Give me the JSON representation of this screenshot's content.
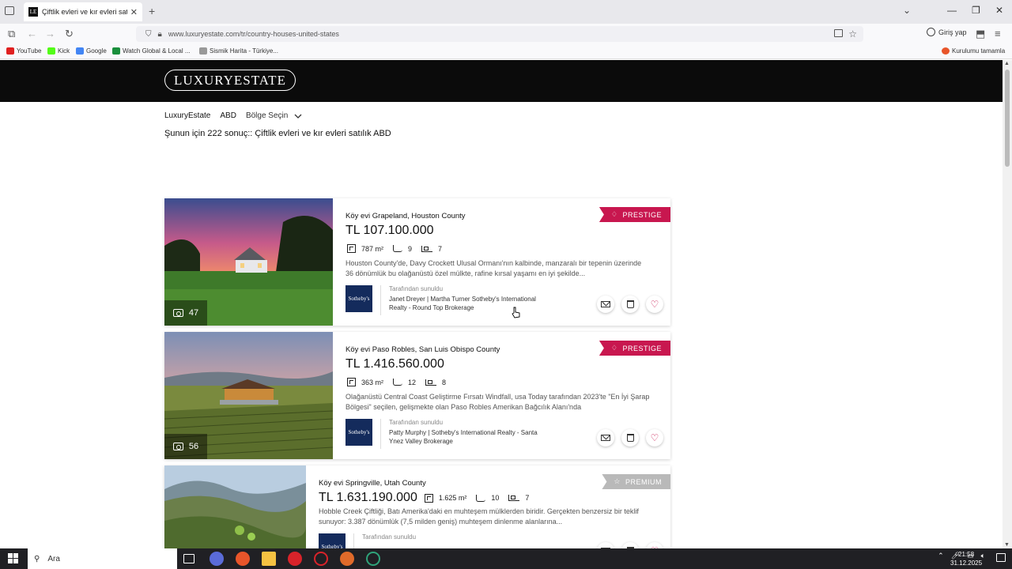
{
  "browser": {
    "tab_title": "Çiftlik evleri ve kır evleri satılık",
    "tab_favicon": "LE",
    "url": "www.luxuryestate.com/tr/country-houses-united-states",
    "signin_label": "Giriş yap",
    "bookmarks": [
      {
        "label": "YouTube",
        "color": "#e02020"
      },
      {
        "label": "Kick",
        "color": "#53fc18"
      },
      {
        "label": "Google",
        "color": "#4285f4"
      },
      {
        "label": "Watch Global & Local ...",
        "color": "#1a8f3c"
      },
      {
        "label": "Sismik Harita - Türkiye...",
        "color": "#999999"
      }
    ],
    "bookmark_right": "Kurulumu tamamla"
  },
  "site": {
    "logo": "LUXURYESTATE",
    "breadcrumb": [
      "LuxuryEstate",
      "ABD"
    ],
    "region_select": "Bölge Seçin",
    "results_text": "Şunun için 222 sonuç:: Çiftlik evleri ve kır evleri satılık ABD"
  },
  "listings": [
    {
      "badge": "PRESTIGE",
      "title": "Köy evi Grapeland, Houston County",
      "price": "TL 107.100.000",
      "area": "787 m²",
      "baths": "9",
      "beds": "7",
      "description": "Houston County'de, Davy Crockett Ulusal Ormanı'nın kalbinde, manzaralı bir tepenin üzerinde 36 dönümlük bu olağanüstü özel mülkte, rafine kırsal yaşamı en iyi şekilde...",
      "photo_count": "47",
      "offered_by": "Tarafından sunuldu",
      "agent": "Janet Dreyer | Martha Turner Sotheby's International Realty - Round Top Brokerage",
      "agency_logo": "Sotheby's"
    },
    {
      "badge": "PRESTIGE",
      "title": "Köy evi Paso Robles, San Luis Obispo County",
      "price": "TL 1.416.560.000",
      "area": "363 m²",
      "baths": "12",
      "beds": "8",
      "description": "Olağanüstü Central Coast Geliştirme Fırsatı Windfall, usa Today tarafından 2023'te \"En İyi Şarap Bölgesi\" seçilen, gelişmekte olan Paso Robles Amerikan Bağcılık Alanı'nda",
      "photo_count": "56",
      "offered_by": "Tarafından sunuldu",
      "agent": "Patty Murphy | Sotheby's International Realty - Santa Ynez Valley Brokerage",
      "agency_logo": "Sotheby's"
    },
    {
      "badge": "PREMIUM",
      "title": "Köy evi Springville, Utah County",
      "price": "TL 1.631.190.000",
      "area": "1.625 m²",
      "baths": "10",
      "beds": "7",
      "description": "Hobble Creek Çiftliği, Batı Amerika'daki en muhteşem mülklerden biridir. Gerçekten benzersiz bir teklif sunuyor: 3.387 dönümlük (7,5 milden geniş) muhteşem dinlenme alanlarına...",
      "offered_by": "Tarafından sunuldu",
      "agency_logo": "Sotheby's"
    }
  ],
  "taskbar": {
    "search_placeholder": "Ara",
    "time": "21:58",
    "date": "31.12.2025"
  },
  "colors": {
    "prestige": "#c8174f",
    "premium": "#b9b9b9",
    "header": "#0b0b0b"
  }
}
